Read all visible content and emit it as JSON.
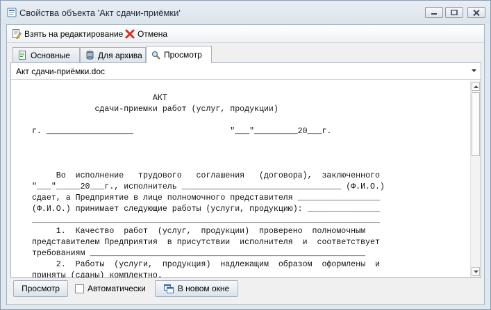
{
  "window": {
    "title": "Свойства объекта 'Акт сдачи-приёмки'"
  },
  "toolbar": {
    "edit_label": "Взять на редактирование",
    "cancel_label": "Отмена"
  },
  "tabs": [
    {
      "label": "Основные",
      "icon": "document-icon"
    },
    {
      "label": "Для архива",
      "icon": "archive-icon"
    },
    {
      "label": "Просмотр",
      "icon": "magnifier-icon",
      "active": true
    }
  ],
  "file_select": {
    "value": "Акт сдачи-приёмки.doc"
  },
  "document": {
    "text": "                         АКТ\n             сдачи-приемки работ (услуг, продукции)\n\nг. __________________                    \"___\"_________20___г.\n\n\n\n     Во  исполнение   трудового   соглашения   (договора),  заключенного\n\"___\"_____20___г., исполнитель _________________________________ (Ф.И.О.)\nсдает, а Предприятие в лице полномочного представителя _________________\n(Ф.И.О.) принимает следующие работы (услуги, продукцию): _______________\n________________________________________________________________________\n     1.  Качество  работ  (услуг,  продукции)  проверено  полномочным\nпредставителем Предприятия  в присутствии  исполнителя  и  соответствует\nтребованиям _________________________________________________________\n     2.  Работы  (услуги,  продукция)  надлежащим  образом  оформлены  и\nприняты (сданы) комплектно."
  },
  "bottom": {
    "preview_label": "Просмотр",
    "auto_label": "Автоматически",
    "new_window_label": "В новом окне"
  }
}
